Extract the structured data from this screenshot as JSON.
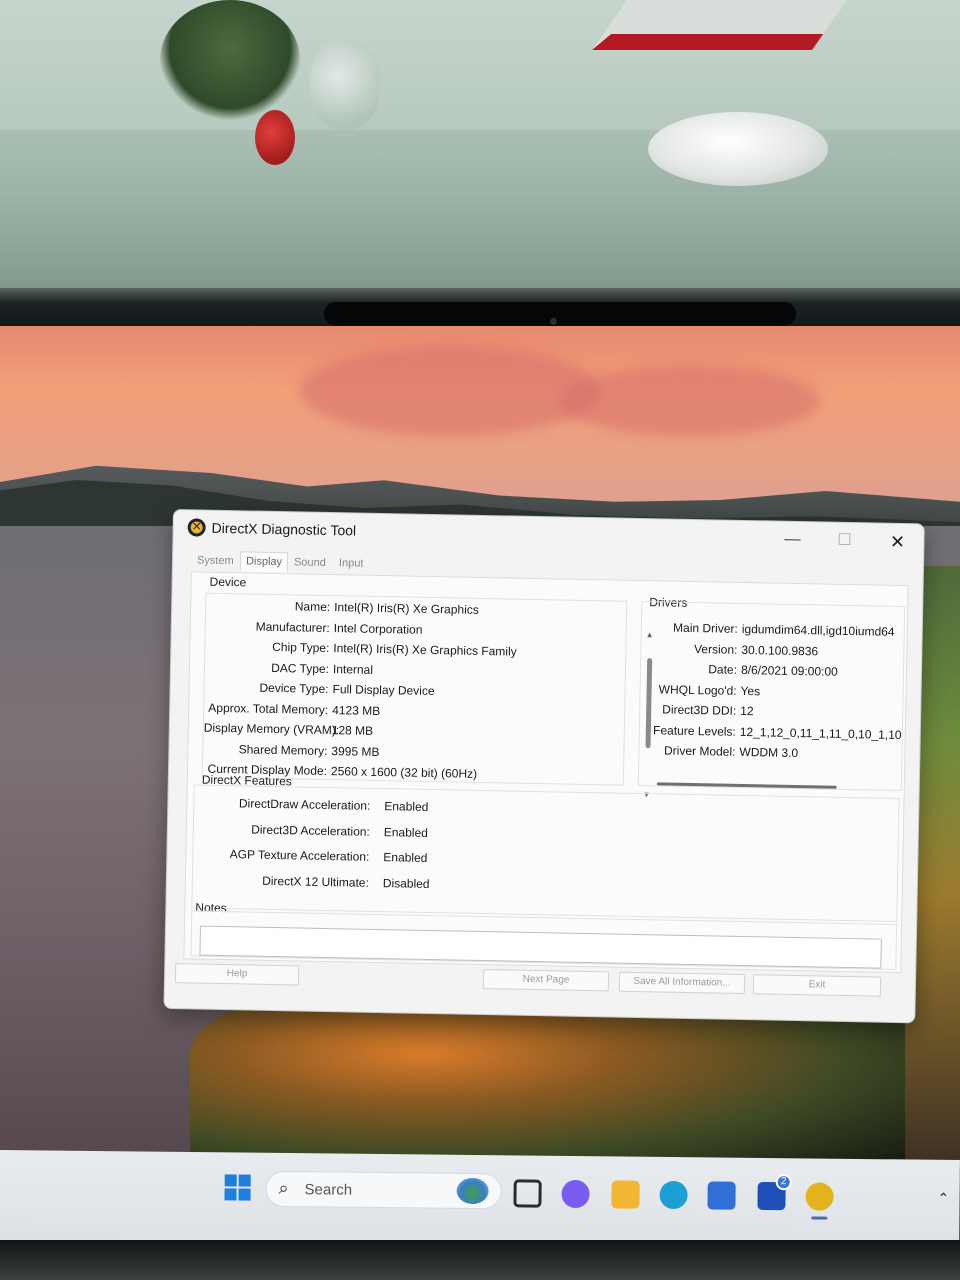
{
  "window": {
    "title": "DirectX Diagnostic Tool",
    "minimize_glyph": "—",
    "maximize_glyph": "☐",
    "close_glyph": "✕"
  },
  "tabs": [
    {
      "label": "System",
      "active": false
    },
    {
      "label": "Display",
      "active": true
    },
    {
      "label": "Sound",
      "active": false
    },
    {
      "label": "Input",
      "active": false
    }
  ],
  "device": {
    "heading": "Device",
    "rows": [
      {
        "label": "Name:",
        "value": "Intel(R) Iris(R) Xe Graphics"
      },
      {
        "label": "Manufacturer:",
        "value": "Intel Corporation"
      },
      {
        "label": "Chip Type:",
        "value": "Intel(R) Iris(R) Xe Graphics Family"
      },
      {
        "label": "DAC Type:",
        "value": "Internal"
      },
      {
        "label": "Device Type:",
        "value": "Full Display Device"
      },
      {
        "label": "Approx. Total Memory:",
        "value": "4123 MB"
      },
      {
        "label": "Display Memory (VRAM):",
        "value": "128 MB"
      },
      {
        "label": "Shared Memory:",
        "value": "3995 MB"
      },
      {
        "label": "Current Display Mode:",
        "value": "2560 x 1600 (32 bit) (60Hz)"
      }
    ]
  },
  "drivers": {
    "heading": "Drivers",
    "rows": [
      {
        "label": "Main Driver:",
        "value": "igdumdim64.dll,igd10iumd64"
      },
      {
        "label": "Version:",
        "value": "30.0.100.9836"
      },
      {
        "label": "Date:",
        "value": "8/6/2021 09:00:00"
      },
      {
        "label": "WHQL Logo'd:",
        "value": "Yes"
      },
      {
        "label": "Direct3D DDI:",
        "value": "12"
      },
      {
        "label": "Feature Levels:",
        "value": "12_1,12_0,11_1,11_0,10_1,10"
      },
      {
        "label": "Driver Model:",
        "value": "WDDM 3.0"
      }
    ]
  },
  "features": {
    "heading": "DirectX Features",
    "rows": [
      {
        "label": "DirectDraw Acceleration:",
        "value": "Enabled"
      },
      {
        "label": "Direct3D Acceleration:",
        "value": "Enabled"
      },
      {
        "label": "AGP Texture Acceleration:",
        "value": "Enabled"
      },
      {
        "label": "DirectX 12 Ultimate:",
        "value": "Disabled"
      }
    ]
  },
  "notes": {
    "heading": "Notes"
  },
  "buttons": {
    "help": "Help",
    "next_page": "Next Page",
    "save_all": "Save All Information...",
    "exit": "Exit"
  },
  "taskbar": {
    "search_placeholder": "Search",
    "badge_count": "2",
    "apps": [
      {
        "icon": "task-view-icon",
        "color": "#2b2b2b"
      },
      {
        "icon": "copilot-icon",
        "color": "#7a5cf0"
      },
      {
        "icon": "file-explorer-icon",
        "color": "#f2b630"
      },
      {
        "icon": "edge-icon",
        "color": "#1d9fd6"
      },
      {
        "icon": "microsoft-store-icon",
        "color": "#2f6fd6"
      },
      {
        "icon": "lenovo-vantage-icon",
        "color": "#1f4fb8"
      },
      {
        "icon": "directx-diagnostic-icon",
        "color": "#e3b21c"
      }
    ]
  }
}
